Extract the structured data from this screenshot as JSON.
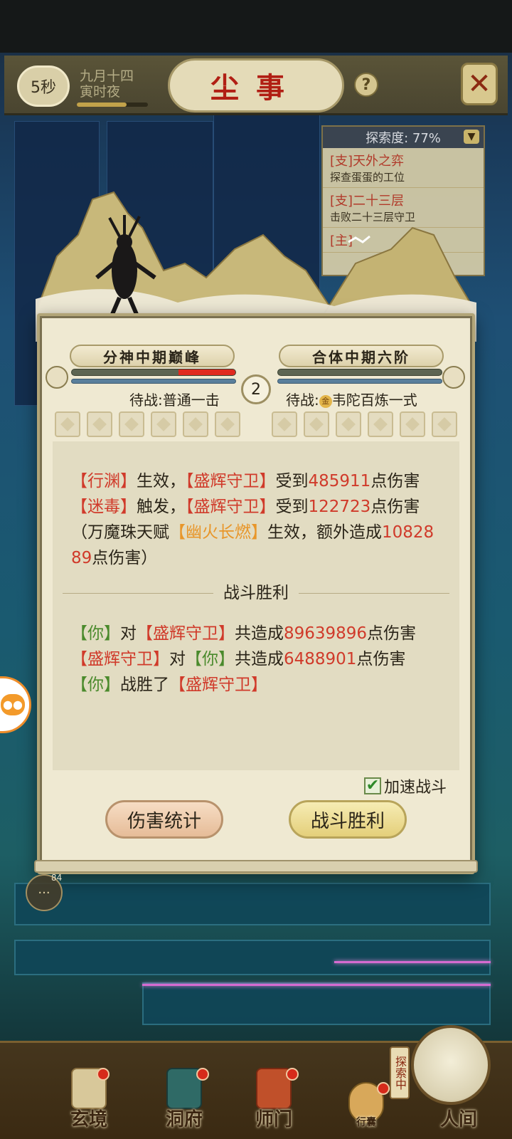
{
  "header": {
    "timer": "5秒",
    "date_line1": "九月十四",
    "date_line2": "寅时夜",
    "title": "尘事",
    "help": "?",
    "close": "✕"
  },
  "explore_panel": {
    "progress_label": "探索度: 77%",
    "tasks": [
      {
        "title": "[支]天外之弈",
        "desc": "探查蛋蛋的工位"
      },
      {
        "title": "[支]二十三层",
        "desc": "击败二十三层守卫"
      },
      {
        "title": "[主]",
        "desc": ""
      }
    ]
  },
  "battle": {
    "left_realm": "分神中期巅峰",
    "right_realm": "合体中期六阶",
    "round": "2",
    "left_standby": "待战:普通一击",
    "right_standby_prefix": "待战:",
    "right_standby_coin": "金",
    "right_standby_skill": "韦陀百炼一式",
    "left_hp_fraction": 0.35,
    "right_hp_fraction": 0.0
  },
  "log": {
    "line1_skill": "【行渊】",
    "line1_mid": "生效，",
    "line1_target": "【盛辉守卫】",
    "line1_pre": "受到",
    "line1_dmg": "485911",
    "line1_post": "点伤害",
    "line2_skill": "【迷毒】",
    "line2_mid": "触发，",
    "line2_target": "【盛辉守卫】",
    "line2_pre": "受到",
    "line2_dmg": "122723",
    "line2_post": "点伤害",
    "line3_pre": "（万魔珠天赋",
    "line3_talent": "【幽火长燃】",
    "line3_mid": "生效，额外造成",
    "line3_dmg": "1082889",
    "line3_post": "点伤害）",
    "divider": "战斗胜利",
    "sum1_you": "【你】",
    "sum1_to": "对",
    "sum1_target": "【盛辉守卫】",
    "sum1_pre": "共造成",
    "sum1_dmg": "89639896",
    "sum1_post": "点伤害",
    "sum2_enemy": "【盛辉守卫】",
    "sum2_to": "对",
    "sum2_you": "【你】",
    "sum2_pre": "共造成",
    "sum2_dmg": "6488901",
    "sum2_post": "点伤害",
    "sum3_you": "【你】",
    "sum3_mid": "战胜了",
    "sum3_enemy": "【盛辉守卫】"
  },
  "speedup": {
    "label": "加速战斗",
    "checked": true,
    "check": "✔"
  },
  "buttons": {
    "stats": "伤害统计",
    "victory": "战斗胜利"
  },
  "side": {
    "chat_count": "84"
  },
  "nav": {
    "xuanjing": "玄境",
    "dongfu": "洞府",
    "shimen": "师门",
    "xingnang": "行囊",
    "exploring_tag": "探索中",
    "renjian": "人间"
  },
  "colors": {
    "enemy": "#d03a2a",
    "you": "#4a8a2c",
    "talent": "#e8962a",
    "title": "#b11f14"
  }
}
